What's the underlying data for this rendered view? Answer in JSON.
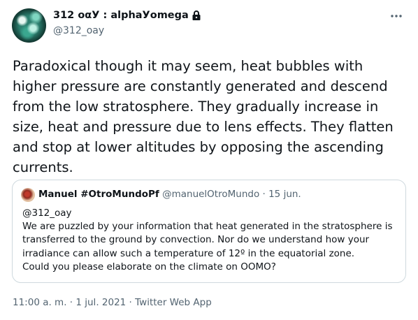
{
  "author": {
    "display_name": "312 οαУ : alphaУomega",
    "handle": "@312_oay",
    "avatar_icon": "profile-avatar",
    "protected_icon": "lock-icon"
  },
  "more_icon": "more-icon",
  "tweet": {
    "text": "Paradoxical though it may seem, heat bubbles with higher pressure are constantly generated and descend from the low stratosphere. They gradually increase in size, heat and pressure due to lens effects. They flatten and stop at lower altitudes by opposing the ascending currents."
  },
  "quote": {
    "name": "Manuel #OtroMundoPf",
    "handle": "@manuelOtroMundo",
    "separator": " · ",
    "date": "15 jun.",
    "lines": [
      "@312_oay",
      "We are puzzled by your information that heat generated in the stratosphere is",
      "transferred to the ground by convection. Nor do we understand how your",
      "irradiance  can allow such a temperature of 12º in the equatorial zone.",
      "Could you please elaborate on the climate on OOMO?"
    ]
  },
  "footer": {
    "time": "11:00 a. m.",
    "date": "1 jul. 2021",
    "source": "Twitter Web App",
    "separator": " · "
  },
  "colors": {
    "text": "#0f1419",
    "secondary": "#536471",
    "border": "#cfd9de"
  }
}
